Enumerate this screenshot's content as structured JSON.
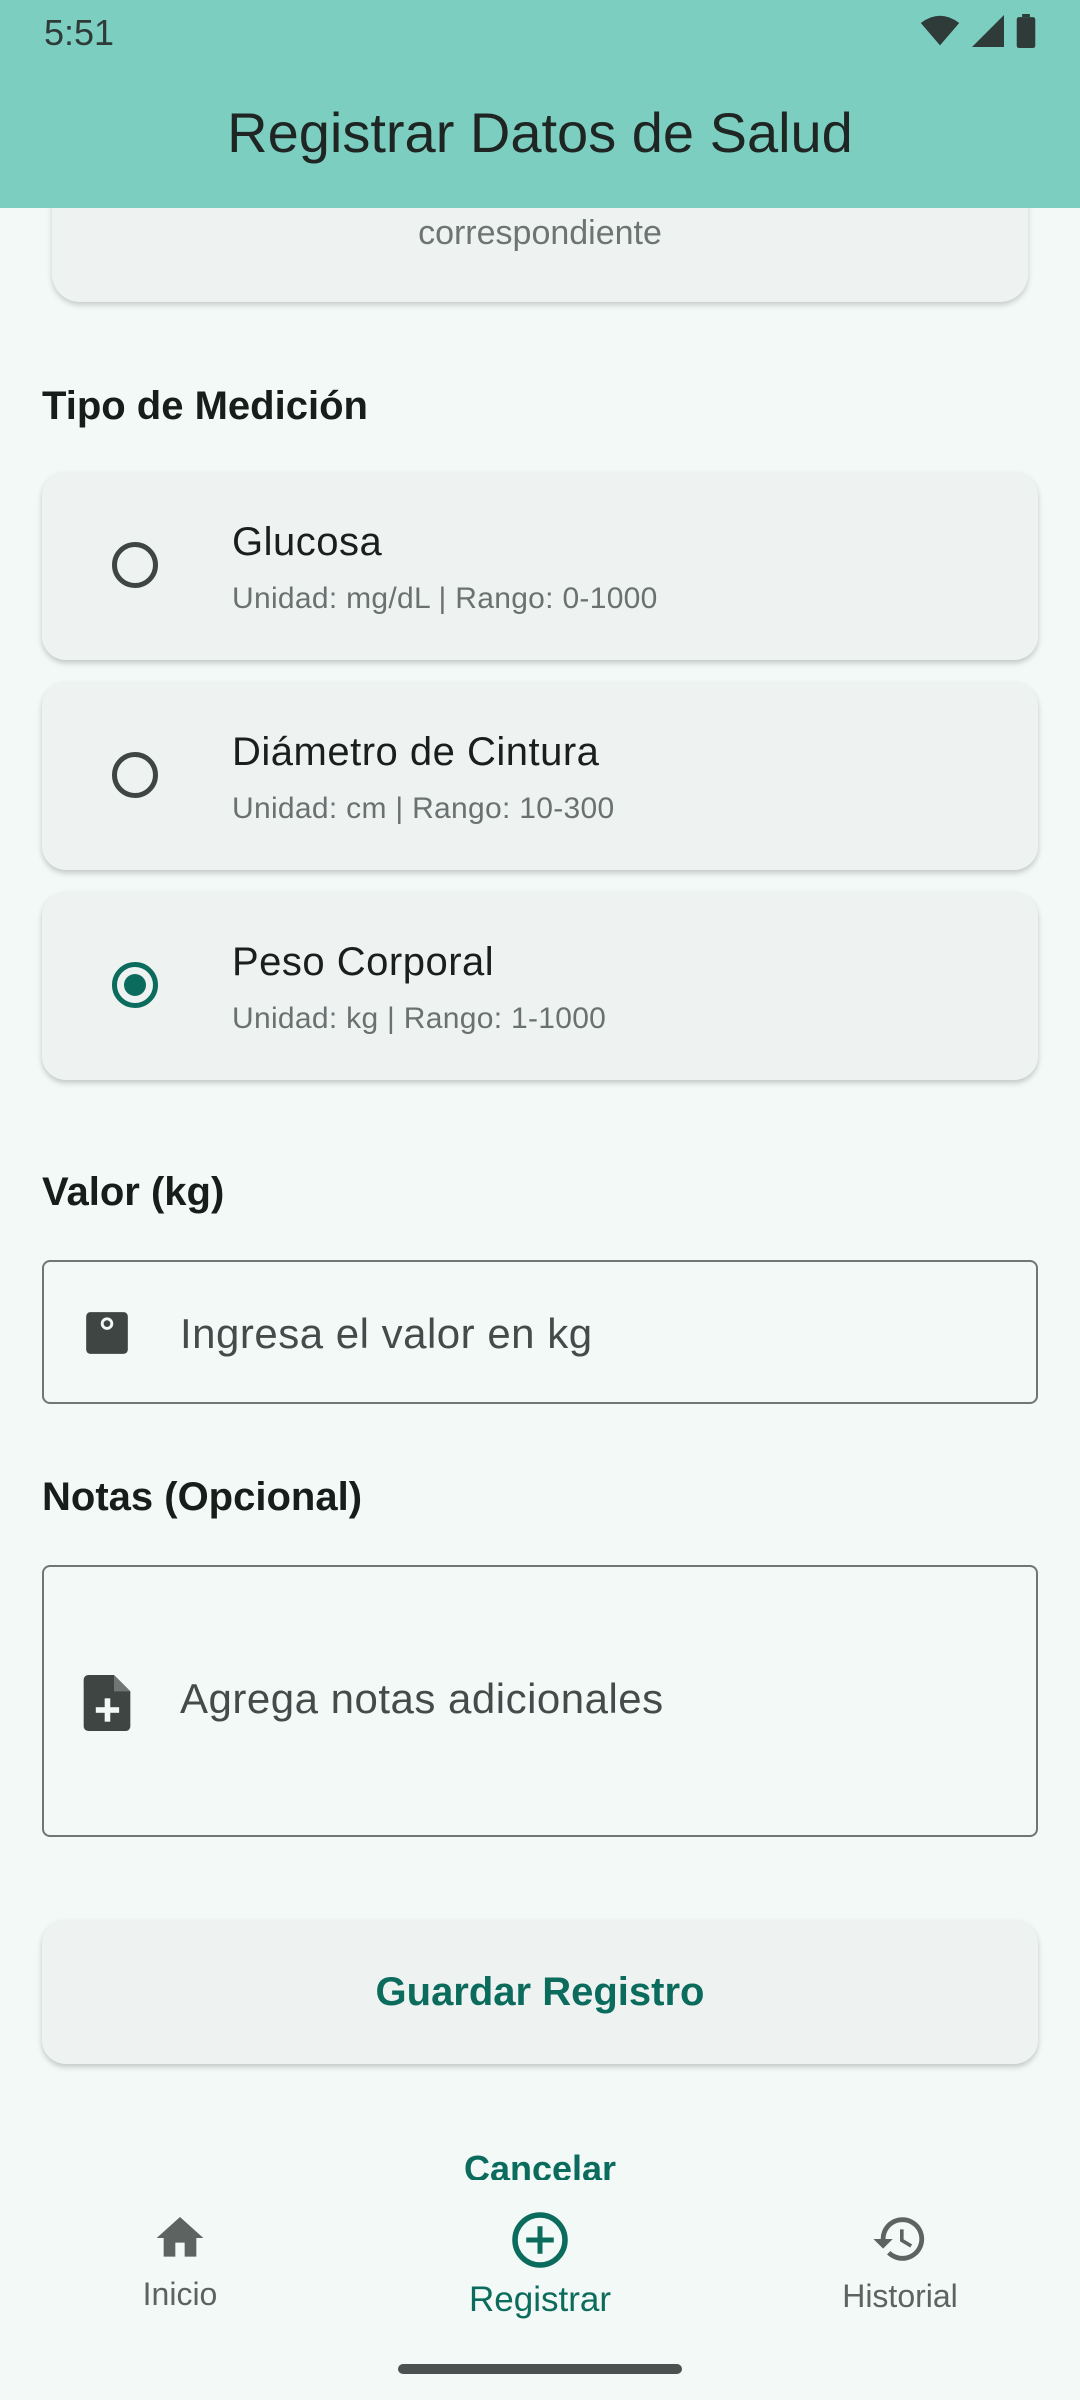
{
  "status_bar": {
    "time": "5:51",
    "icons": [
      "wifi-icon",
      "signal-icon",
      "battery-icon"
    ]
  },
  "app_bar": {
    "title": "Registrar Datos de Salud"
  },
  "info_card": {
    "text": "correspondiente"
  },
  "measurement": {
    "section_label": "Tipo de Medición",
    "options": [
      {
        "title": "Glucosa",
        "subtitle": "Unidad: mg/dL | Rango: 0-1000",
        "selected": false
      },
      {
        "title": "Diámetro de Cintura",
        "subtitle": "Unidad: cm | Rango: 10-300",
        "selected": false
      },
      {
        "title": "Peso Corporal",
        "subtitle": "Unidad: kg | Rango: 1-1000",
        "selected": true
      }
    ]
  },
  "value_field": {
    "label": "Valor (kg)",
    "value": "",
    "placeholder": "Ingresa el valor en kg",
    "icon": "scale-icon"
  },
  "notes_field": {
    "label": "Notas (Opcional)",
    "value": "",
    "placeholder": "Agrega notas adicionales",
    "icon": "note-add-icon"
  },
  "actions": {
    "save_label": "Guardar Registro",
    "cancel_label": "Cancelar"
  },
  "bottom_nav": {
    "items": [
      {
        "label": "Inicio",
        "icon": "home-icon",
        "active": false
      },
      {
        "label": "Registrar",
        "icon": "add-circle-icon",
        "active": true
      },
      {
        "label": "Historial",
        "icon": "history-icon",
        "active": false
      }
    ]
  },
  "colors": {
    "app_bar": "#7ccfc0",
    "accent": "#0b6b5c",
    "background": "#f3f9f7",
    "card": "#eef3f2"
  }
}
